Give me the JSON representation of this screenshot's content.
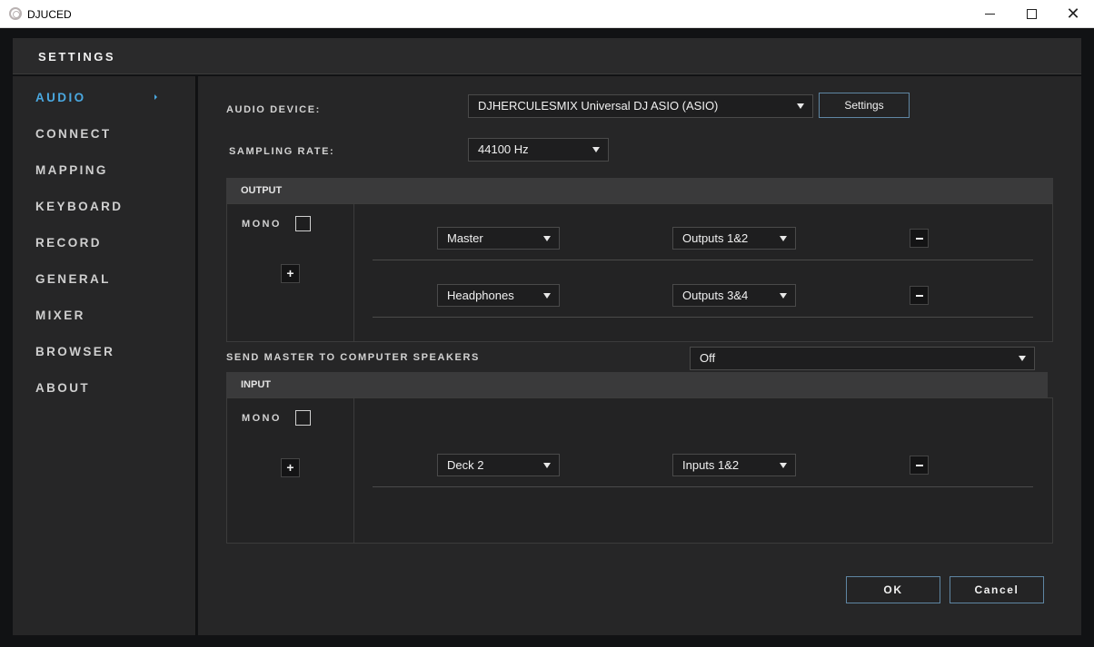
{
  "window": {
    "title": "DJUCED",
    "minimize": "minimize",
    "maximize": "maximize",
    "close": "close"
  },
  "settings": {
    "title": "SETTINGS"
  },
  "sidebar": {
    "items": [
      {
        "label": "AUDIO",
        "active": true
      },
      {
        "label": "CONNECT"
      },
      {
        "label": "MAPPING"
      },
      {
        "label": "KEYBOARD"
      },
      {
        "label": "RECORD"
      },
      {
        "label": "GENERAL"
      },
      {
        "label": "MIXER"
      },
      {
        "label": "BROWSER"
      },
      {
        "label": "ABOUT"
      }
    ]
  },
  "audio": {
    "device_label": "AUDIO DEVICE:",
    "device_value": "DJHERCULESMIX Universal DJ ASIO (ASIO)",
    "settings_button": "Settings",
    "sampling_label": "SAMPLING RATE:",
    "sampling_value": "44100 Hz",
    "send_master_label": "SEND MASTER TO COMPUTER SPEAKERS",
    "send_master_value": "Off"
  },
  "output": {
    "header": "OUTPUT",
    "mono_label": "MONO",
    "add_button": "+",
    "rows": [
      {
        "source": "Master",
        "target": "Outputs 1&2"
      },
      {
        "source": "Headphones",
        "target": "Outputs 3&4"
      }
    ]
  },
  "input": {
    "header": "INPUT",
    "mono_label": "MONO",
    "add_button": "+",
    "rows": [
      {
        "source": "Deck 2",
        "target": "Inputs 1&2"
      }
    ]
  },
  "footer": {
    "ok": "OK",
    "cancel": "Cancel"
  },
  "colors": {
    "accent": "#4aa8e0",
    "button_border": "#5f86a3",
    "panel_bg": "#262627"
  }
}
